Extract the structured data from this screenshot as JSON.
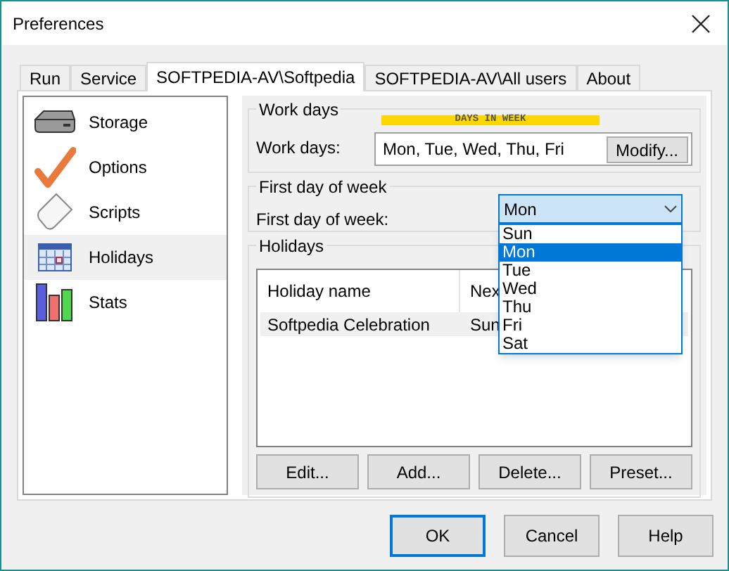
{
  "window": {
    "title": "Preferences"
  },
  "tabs": [
    {
      "label": "Run",
      "selected": false
    },
    {
      "label": "Service",
      "selected": false
    },
    {
      "label": "SOFTPEDIA-AV\\Softpedia",
      "selected": true
    },
    {
      "label": "SOFTPEDIA-AV\\All users",
      "selected": false
    },
    {
      "label": "About",
      "selected": false
    }
  ],
  "sidebar": {
    "items": [
      {
        "kind": "storage",
        "label": "Storage",
        "selected": false
      },
      {
        "kind": "options",
        "label": "Options",
        "selected": false
      },
      {
        "kind": "scripts",
        "label": "Scripts",
        "selected": false
      },
      {
        "kind": "holidays",
        "label": "Holidays",
        "selected": true
      },
      {
        "kind": "stats",
        "label": "Stats",
        "selected": false
      }
    ]
  },
  "work_days": {
    "group_title": "Work days",
    "banner": "DAYS IN WEEK",
    "label": "Work days:",
    "value": "Mon, Tue, Wed, Thu, Fri",
    "button": "Modify..."
  },
  "first_day": {
    "group_title": "First day of week",
    "label": "First day of week:",
    "value": "Mon",
    "expanded": true,
    "options": [
      {
        "label": "Sun",
        "selected": false
      },
      {
        "label": "Mon",
        "selected": true
      },
      {
        "label": "Tue",
        "selected": false
      },
      {
        "label": "Wed",
        "selected": false
      },
      {
        "label": "Thu",
        "selected": false
      },
      {
        "label": "Fri",
        "selected": false
      },
      {
        "label": "Sat",
        "selected": false
      }
    ]
  },
  "holidays": {
    "group_title": "Holidays",
    "columns": [
      "Holiday name",
      "Nex"
    ],
    "rows": [
      {
        "cells": [
          "Softpedia Celebration",
          "Sun"
        ],
        "selected": true
      }
    ],
    "buttons": [
      "Edit...",
      "Add...",
      "Delete...",
      "Preset..."
    ]
  },
  "buttons": [
    {
      "label": "OK",
      "default": true
    },
    {
      "label": "Cancel",
      "default": false
    },
    {
      "label": "Help",
      "default": false
    }
  ]
}
